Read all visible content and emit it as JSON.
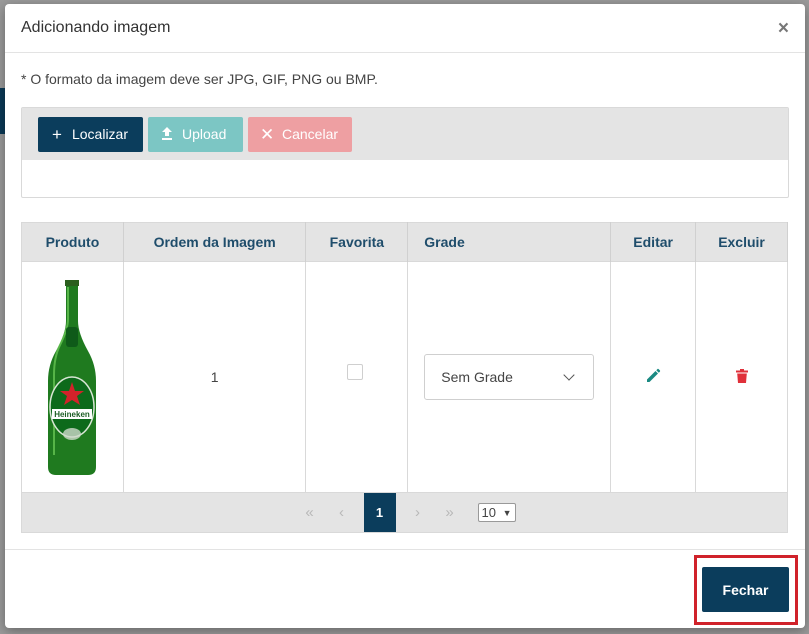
{
  "modal": {
    "title": "Adicionando imagem",
    "close_glyph": "×",
    "hint": "* O formato da imagem deve ser JPG, GIF, PNG ou BMP."
  },
  "toolbar": {
    "localizar_label": "Localizar",
    "upload_label": "Upload",
    "cancelar_label": "Cancelar"
  },
  "table": {
    "headers": [
      "Produto",
      "Ordem da Imagem",
      "Favorita",
      "Grade",
      "Editar",
      "Excluir"
    ],
    "rows": [
      {
        "product_image": "heineken-bottle",
        "ordem": "1",
        "favorita": false,
        "grade": "Sem Grade"
      }
    ]
  },
  "pager": {
    "current_page": "1",
    "page_size": "10"
  },
  "footer": {
    "fechar_label": "Fechar"
  },
  "colors": {
    "primary": "#0b3d5c",
    "upload": "#7cc6c4",
    "cancel": "#ee9fa2",
    "edit": "#1a8a82",
    "delete": "#e0303a",
    "highlight": "#d0222a"
  }
}
